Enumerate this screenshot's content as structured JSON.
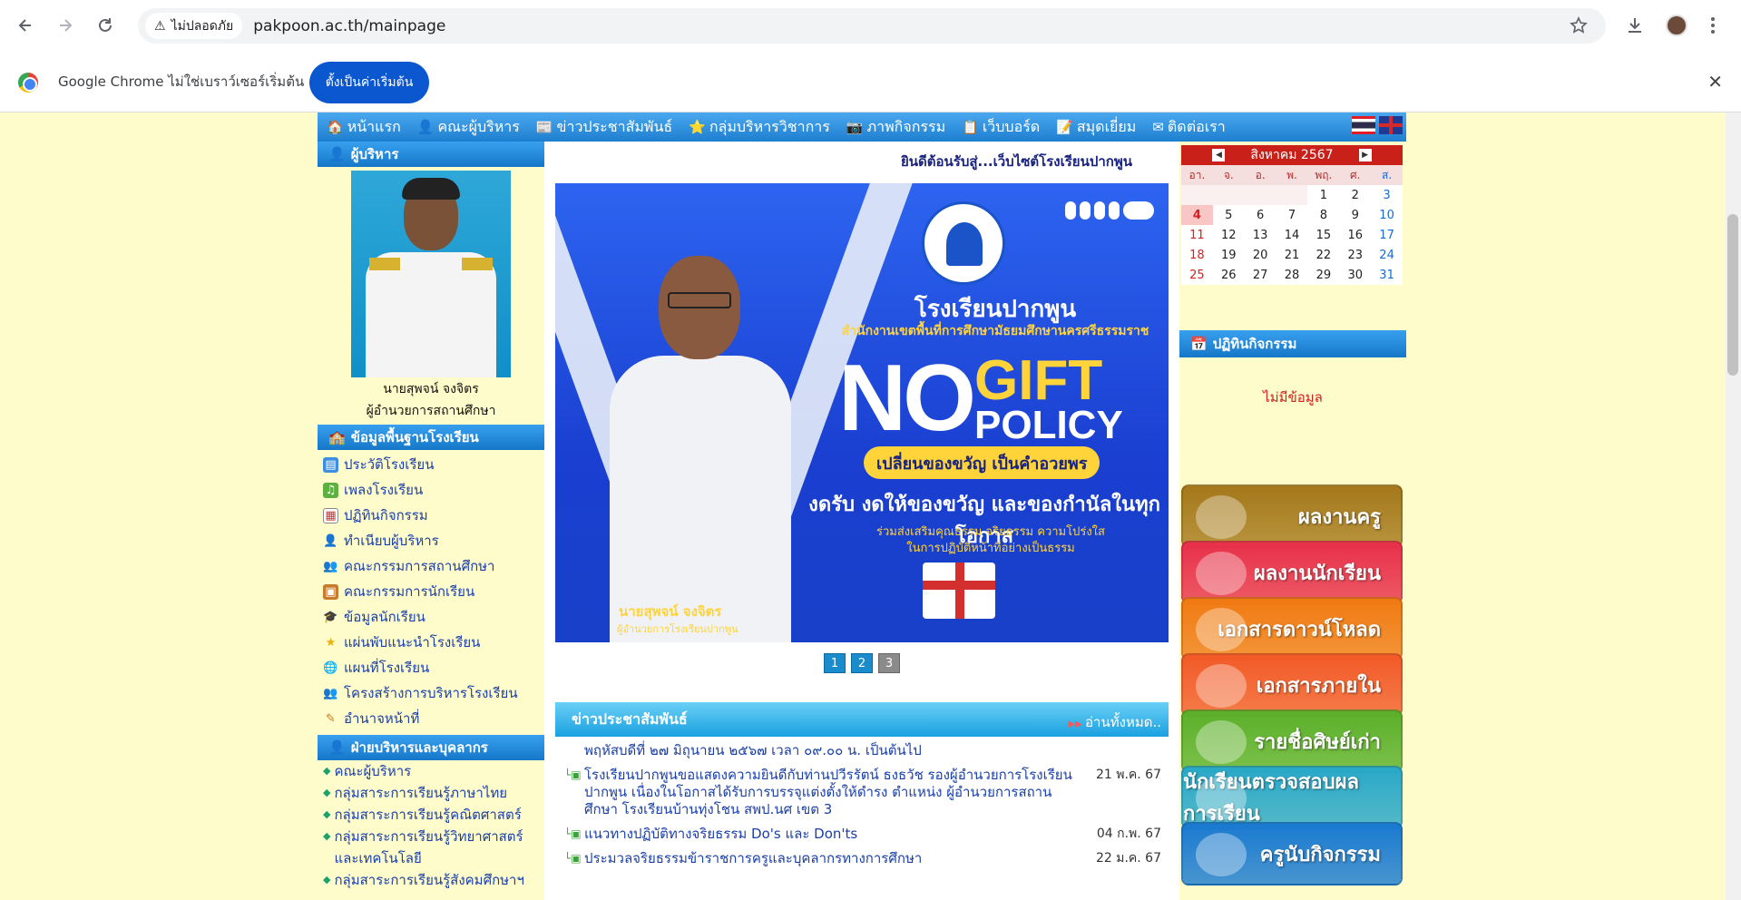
{
  "browser": {
    "security_label": "ไม่ปลอดภัย",
    "url": "pakpoon.ac.th/mainpage",
    "info_text": "Google Chrome ไม่ใช่เบราว์เซอร์เริ่มต้น",
    "default_button": "ตั้งเป็นค่าเริ่มต้น"
  },
  "nav": [
    {
      "icon": "home-icon",
      "label": "หน้าแรก"
    },
    {
      "icon": "people-icon",
      "label": "คณะผู้บริหาร"
    },
    {
      "icon": "news-icon",
      "label": "ข่าวประชาสัมพันธ์"
    },
    {
      "icon": "star-icon",
      "label": "กลุ่มบริหารวิชาการ"
    },
    {
      "icon": "camera-icon",
      "label": "ภาพกิจกรรม"
    },
    {
      "icon": "board-icon",
      "label": "เว็บบอร์ด"
    },
    {
      "icon": "book-icon",
      "label": "สมุดเยี่ยม"
    },
    {
      "icon": "mail-icon",
      "label": "ติดต่อเรา"
    }
  ],
  "left": {
    "exec_heading": "ผู้บริหาร",
    "exec_name": "นายสุพจน์ จงจิตร",
    "exec_title": "ผู้อำนวยการสถานศึกษา",
    "info_heading": "ข้อมูลพื้นฐานโรงเรียน",
    "info_items": [
      "ประวัติโรงเรียน",
      "เพลงโรงเรียน",
      "ปฏิทินกิจกรรม",
      "ทำเนียบผู้บริหาร",
      "คณะกรรมการสถานศึกษา",
      "คณะกรรมการนักเรียน",
      "ข้อมูลนักเรียน",
      "แผ่นพับแนะนำโรงเรียน",
      "แผนที่โรงเรียน",
      "โครงสร้างการบริหารโรงเรียน",
      "อำนาจหน้าที่"
    ],
    "dept_heading": "ฝ่ายบริหารและบุคลากร",
    "dept_items": [
      "คณะผู้บริหาร",
      "กลุ่มสาระการเรียนรู้ภาษาไทย",
      "กลุ่มสาระการเรียนรู้คณิตศาสตร์",
      "กลุ่มสาระการเรียนรู้วิทยาศาสตร์และเทคโนโลยี",
      "กลุ่มสาระการเรียนรู้สังคมศึกษาฯ"
    ]
  },
  "center": {
    "welcome": "ยินดีต้อนรับสู่...เว็บไซต์โรงเรียนปากพูน",
    "banner": {
      "school": "โรงเรียนปากพูน",
      "office": "สำนักงานเขตพื้นที่การศึกษามัธยมศึกษานครศรีธรรมราช",
      "no": "NO",
      "gift": "GIFT",
      "policy": "POLICY",
      "pill": "เปลี่ยนของขวัญ เป็นคำอวยพร",
      "main": "งดรับ งดให้ของขวัญ และของกำนัลในทุกโอกาส",
      "sub1": "ร่วมส่งเสริมคุณธรรม จริยธรรม ความโปร่งใส",
      "sub2": "ในการปฏิบัติหน้าที่อย่างเป็นธรรม",
      "caption_name": "นายสุพจน์ จงจิตร",
      "caption_title": "ผู้อำนวยการโรงเรียนปากพูน"
    },
    "pages": [
      "1",
      "2",
      "3"
    ],
    "current_page": "3",
    "news_heading": "ข่าวประชาสัมพันธ์",
    "read_all": "อ่านทั้งหมด..",
    "news": [
      {
        "text": "พฤหัสบดีที่ ๒๗ มิถุนายน ๒๕๖๗ เวลา ๐๙.๐๐ น. เป็นต้นไป",
        "date": ""
      },
      {
        "text": "โรงเรียนปากพูนขอแสดงความยินดีกับท่านปวีรรัตน์ ธงธวัช รองผู้อำนวยการโรงเรียนปากพูน เนื่องในโอกาสได้รับการบรรจุแต่งตั้งให้ดำรง ตำแหน่ง ผู้อำนวยการสถานศึกษา โรงเรียนบ้านทุ่งโชน สพป.นศ เขต 3",
        "date": "21 พ.ค. 67"
      },
      {
        "text": "แนวทางปฏิบัติทางจริยธรรม Do's และ Don'ts",
        "date": "04 ก.พ. 67"
      },
      {
        "text": "ประมวลจริยธรรมข้าราชการครูและบุคลากรทางการศึกษา",
        "date": "22 ม.ค. 67"
      }
    ]
  },
  "right": {
    "calendar": {
      "title": "สิงหาคม 2567",
      "dow": [
        "อา.",
        "จ.",
        "อ.",
        "พ.",
        "พฤ.",
        "ศ.",
        "ส."
      ],
      "days": [
        "",
        "",
        "",
        "",
        "1",
        "2",
        "3",
        "4",
        "5",
        "6",
        "7",
        "8",
        "9",
        "10",
        "11",
        "12",
        "13",
        "14",
        "15",
        "16",
        "17",
        "18",
        "19",
        "20",
        "21",
        "22",
        "23",
        "24",
        "25",
        "26",
        "27",
        "28",
        "29",
        "30",
        "31"
      ],
      "today": "4"
    },
    "activity_heading": "ปฏิทินกิจกรรม",
    "no_data": "ไม่มีข้อมูล",
    "buttons": [
      {
        "label": "ผลงานครู",
        "color": "#a5781a"
      },
      {
        "label": "ผลงานนักเรียน",
        "color": "#e8304a"
      },
      {
        "label": "เอกสารดาวน์โหลด",
        "color": "#f07a12"
      },
      {
        "label": "เอกสารภายใน",
        "color": "#f25a28"
      },
      {
        "label": "รายชื่อศิษย์เก่า",
        "color": "#5bb02a"
      },
      {
        "label": "นักเรียนตรวจสอบผลการเรียน",
        "color": "#2aa8c8"
      },
      {
        "label": "ครูนับกิจกรรม",
        "color": "#1a7ad0"
      }
    ]
  }
}
